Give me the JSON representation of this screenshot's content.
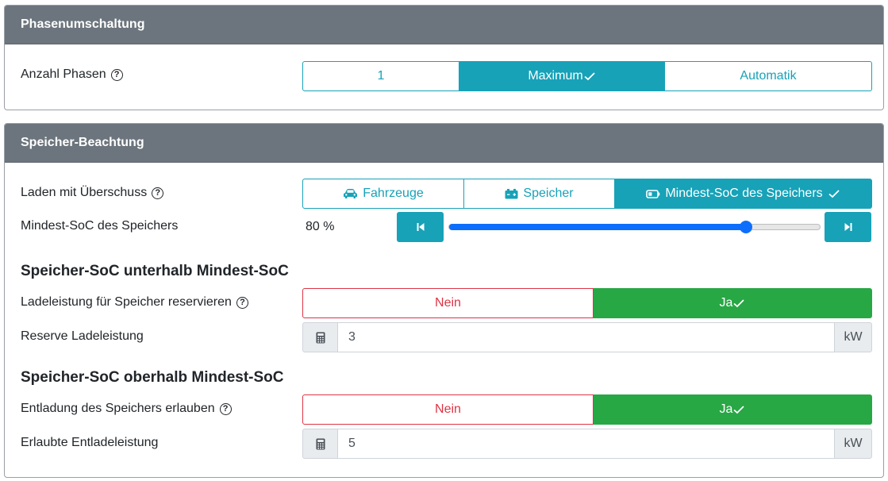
{
  "phase_card": {
    "title": "Phasenumschaltung",
    "label": "Anzahl Phasen",
    "help": "?",
    "options": [
      {
        "label": "1",
        "active": false
      },
      {
        "label": "Maximum",
        "active": true
      },
      {
        "label": "Automatik",
        "active": false
      }
    ]
  },
  "storage_card": {
    "title": "Speicher-Beachtung",
    "surplus_label": "Laden mit Überschuss",
    "help": "?",
    "surplus_options": [
      {
        "label": "Fahrzeuge",
        "icon": "car-icon",
        "active": false
      },
      {
        "label": "Speicher",
        "icon": "car-battery-icon",
        "active": false
      },
      {
        "label": "Mindest-SoC des Speichers",
        "icon": "battery-icon",
        "active": true
      }
    ],
    "min_soc_label": "Mindest-SoC des Speichers",
    "min_soc_value": "80 %",
    "min_soc_percent": 80,
    "below_title": "Speicher-SoC unterhalb Mindest-SoC",
    "reserve_toggle_label": "Ladeleistung für Speicher reservieren",
    "reserve_no": "Nein",
    "reserve_yes": "Ja",
    "reserve_power_label": "Reserve Ladeleistung",
    "reserve_power_value": "3",
    "reserve_power_unit": "kW",
    "above_title": "Speicher-SoC oberhalb Mindest-SoC",
    "discharge_toggle_label": "Entladung des Speichers erlauben",
    "discharge_no": "Nein",
    "discharge_yes": "Ja",
    "discharge_power_label": "Erlaubte Entladeleistung",
    "discharge_power_value": "5",
    "discharge_power_unit": "kW"
  },
  "colors": {
    "header": "#6c757d",
    "info": "#17a2b8",
    "danger": "#dc3545",
    "success": "#28a745",
    "slider": "#0d6efd"
  }
}
